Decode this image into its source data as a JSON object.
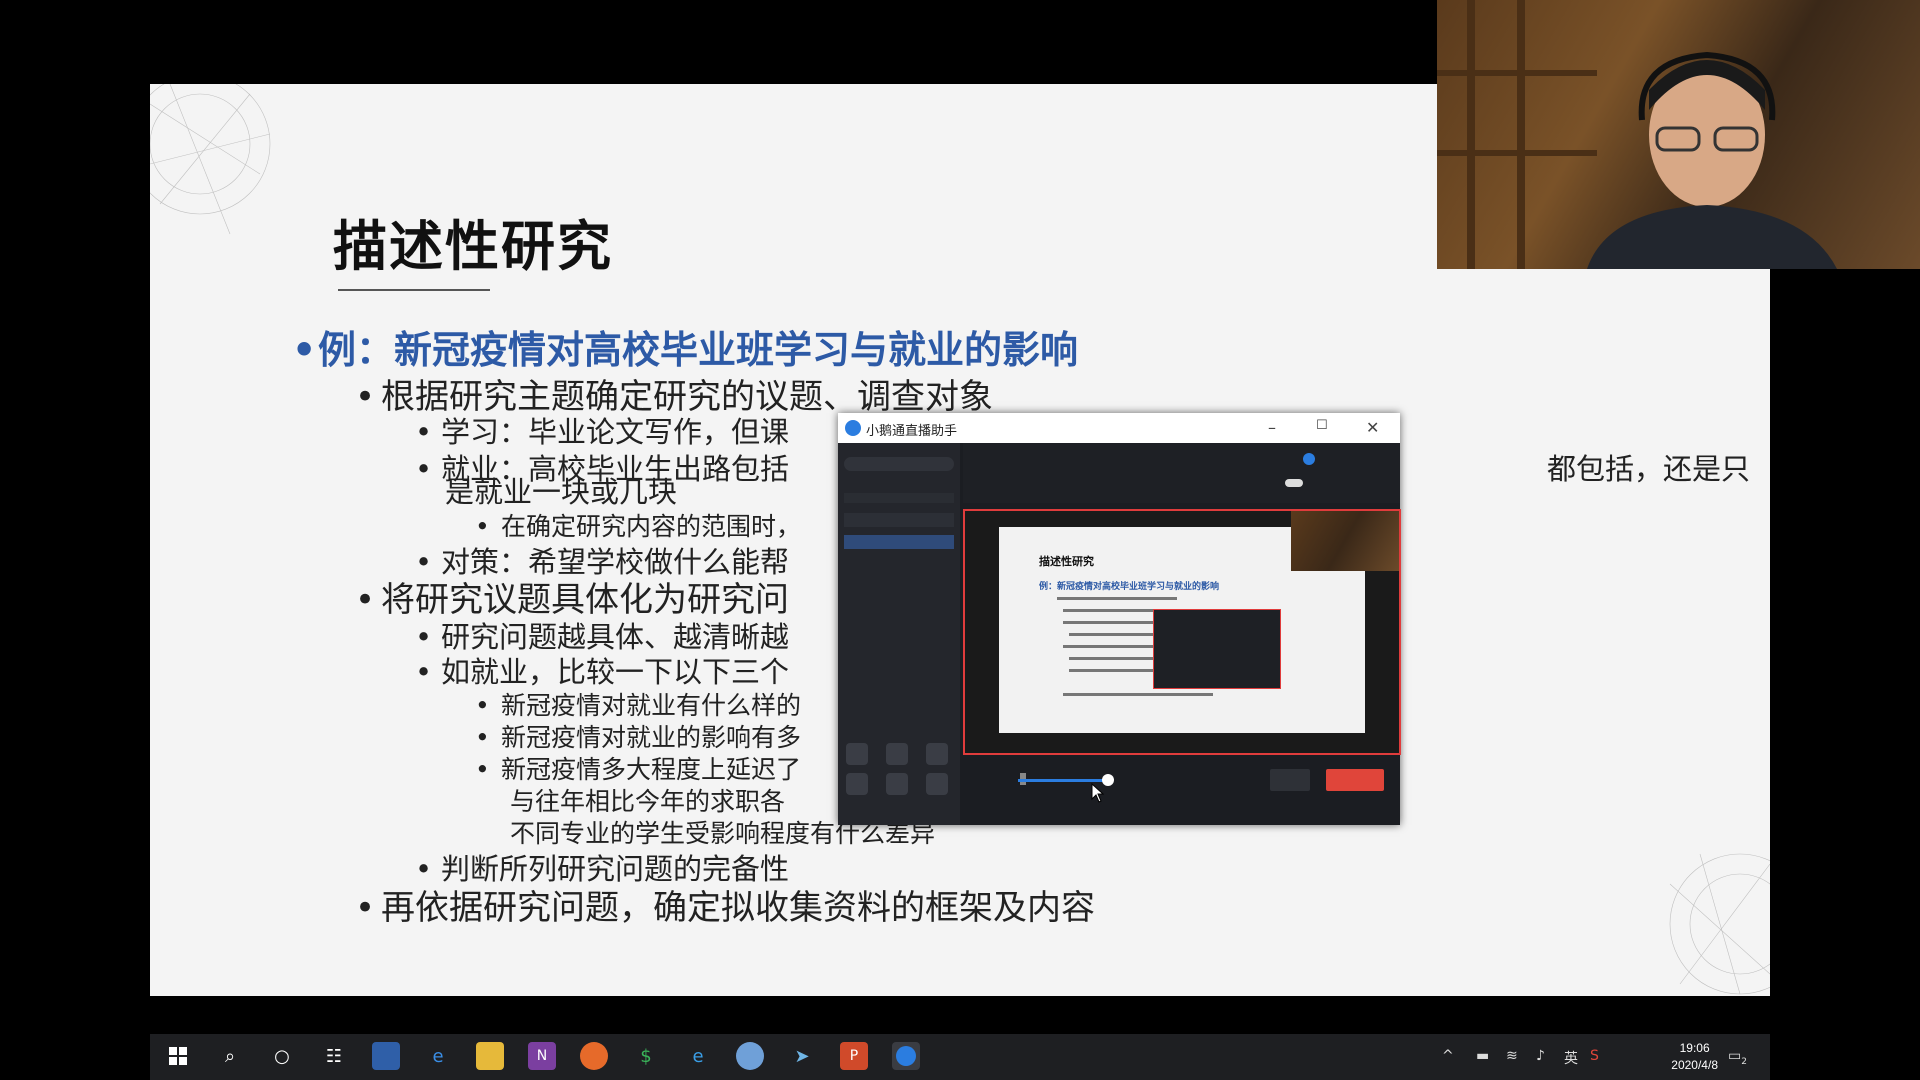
{
  "slide": {
    "title": "描述性研究",
    "bullets": [
      {
        "level": 0,
        "text": "例：新冠疫情对高校毕业班学习与就业的影响"
      },
      {
        "level": 1,
        "text": "根据研究主题确定研究的议题、调查对象"
      },
      {
        "level": 2,
        "text": "学习：毕业论文写作，但课"
      },
      {
        "level": 2,
        "text": "就业：高校毕业生出路包括"
      },
      {
        "level": 3,
        "text": "在确定研究内容的范围时，"
      },
      {
        "level": 2,
        "text": "对策：希望学校做什么能帮"
      },
      {
        "level": 1,
        "text": "将研究议题具体化为研究问"
      },
      {
        "level": 2,
        "text": "研究问题越具体、越清晰越"
      },
      {
        "level": 2,
        "text": "如就业，比较一下以下三个"
      },
      {
        "level": 3,
        "text": "新冠疫情对就业有什么样的"
      },
      {
        "level": 3,
        "text": "新冠疫情对就业的影响有多"
      },
      {
        "level": 3,
        "text": "新冠疫情多大程度上延迟了"
      },
      {
        "level": 2,
        "text": "判断所列研究问题的完备性"
      },
      {
        "level": 1,
        "text": "再依据研究问题，确定拟收集资料的框架及内容"
      }
    ],
    "continuations": [
      {
        "text": "都包括，还是只"
      },
      {
        "text": "是就业一块或几块"
      },
      {
        "text": "与往年相比今年的求职各"
      },
      {
        "text": "不同专业的学生受影响程度有什么差异"
      }
    ]
  },
  "app_window": {
    "title": "小鹅通直播助手",
    "minimize": "–",
    "maximize": "☐",
    "close": "✕",
    "preview_title": "描述性研究",
    "preview_subtitle": "例：新冠疫情对高校毕业班学习与就业的影响"
  },
  "taskbar": {
    "clock_time": "19:06",
    "clock_date": "2020/4/8",
    "ime": "英",
    "notification_count": "2",
    "icons": [
      "windows-start",
      "search",
      "cortana",
      "task-view",
      "app-1",
      "edge",
      "file-explorer",
      "onenote",
      "firefox",
      "app-green",
      "ie",
      "app-globe",
      "app-arrow",
      "powerpoint",
      "live-assistant"
    ]
  },
  "colors": {
    "slide_bg": "#f4f4f4",
    "heading_blue": "#2d5aa6",
    "start_red": "#e0453a",
    "taskbar": "#1e1f22"
  }
}
